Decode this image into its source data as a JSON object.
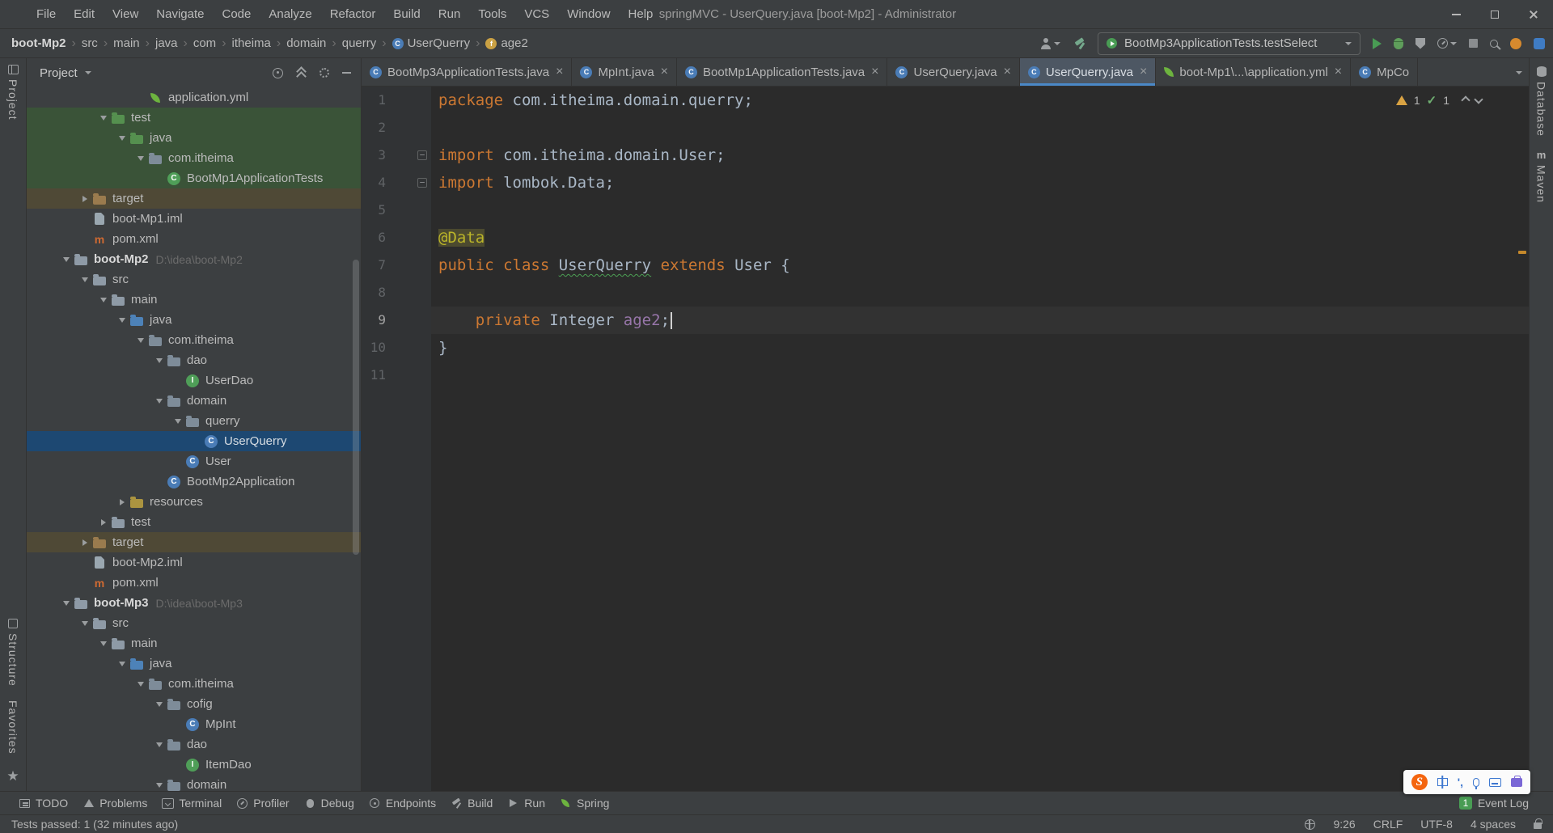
{
  "titlebar": {
    "menus": [
      "File",
      "Edit",
      "View",
      "Navigate",
      "Code",
      "Analyze",
      "Refactor",
      "Build",
      "Run",
      "Tools",
      "VCS",
      "Window",
      "Help"
    ],
    "title": "springMVC - UserQuery.java [boot-Mp2] - Administrator"
  },
  "navbar": {
    "breadcrumbs": [
      {
        "label": "boot-Mp2",
        "bold": true
      },
      {
        "label": "src"
      },
      {
        "label": "main"
      },
      {
        "label": "java"
      },
      {
        "label": "com"
      },
      {
        "label": "itheima"
      },
      {
        "label": "domain"
      },
      {
        "label": "querry"
      },
      {
        "label": "UserQuerry",
        "icon": "class"
      },
      {
        "label": "age2",
        "icon": "field"
      }
    ],
    "run_config": "BootMp3ApplicationTests.testSelect",
    "actions": [
      "vcs-users",
      "build-hammer",
      "run",
      "debug",
      "coverage",
      "profiler",
      "stop",
      "search-everywhere",
      "updates",
      "plugin"
    ]
  },
  "left_stripe": {
    "project": "Project",
    "structure": "Structure",
    "favorites": "Favorites"
  },
  "right_stripe": {
    "database": "Database",
    "maven": "Maven"
  },
  "project_panel": {
    "title": "Project",
    "tree": [
      {
        "label": "application.yml",
        "level": 5,
        "icon": "spring"
      },
      {
        "label": "test",
        "level": 3,
        "icon": "folder-test",
        "chevron": "open",
        "row": "green"
      },
      {
        "label": "java",
        "level": 4,
        "icon": "folder-test",
        "chevron": "open",
        "row": "green"
      },
      {
        "label": "com.itheima",
        "level": 5,
        "icon": "package",
        "chevron": "open",
        "row": "green"
      },
      {
        "label": "BootMp1ApplicationTests",
        "level": 6,
        "icon": "class-test",
        "row": "green"
      },
      {
        "label": "target",
        "level": 2,
        "icon": "folder-excluded",
        "chevron": "closed",
        "row": "orange"
      },
      {
        "label": "boot-Mp1.iml",
        "level": 2,
        "icon": "file"
      },
      {
        "label": "pom.xml",
        "level": 2,
        "icon": "maven-file"
      },
      {
        "label": "boot-Mp2",
        "level": 1,
        "icon": "module",
        "chevron": "open",
        "bold": true,
        "extra": "D:\\idea\\boot-Mp2"
      },
      {
        "label": "src",
        "level": 2,
        "icon": "folder",
        "chevron": "open"
      },
      {
        "label": "main",
        "level": 3,
        "icon": "folder",
        "chevron": "open"
      },
      {
        "label": "java",
        "level": 4,
        "icon": "folder-source",
        "chevron": "open"
      },
      {
        "label": "com.itheima",
        "level": 5,
        "icon": "package",
        "chevron": "open"
      },
      {
        "label": "dao",
        "level": 6,
        "icon": "package",
        "chevron": "open"
      },
      {
        "label": "UserDao",
        "level": 7,
        "icon": "interface"
      },
      {
        "label": "domain",
        "level": 6,
        "icon": "package",
        "chevron": "open"
      },
      {
        "label": "querry",
        "level": 7,
        "icon": "package",
        "chevron": "open"
      },
      {
        "label": "UserQuerry",
        "level": 8,
        "icon": "class",
        "row": "selected"
      },
      {
        "label": "User",
        "level": 7,
        "icon": "class"
      },
      {
        "label": "BootMp2Application",
        "level": 6,
        "icon": "class"
      },
      {
        "label": "resources",
        "level": 4,
        "icon": "folder-resources",
        "chevron": "closed"
      },
      {
        "label": "test",
        "level": 3,
        "icon": "folder",
        "chevron": "closed"
      },
      {
        "label": "target",
        "level": 2,
        "icon": "folder-excluded",
        "chevron": "closed",
        "row": "orange"
      },
      {
        "label": "boot-Mp2.iml",
        "level": 2,
        "icon": "file"
      },
      {
        "label": "pom.xml",
        "level": 2,
        "icon": "maven-file"
      },
      {
        "label": "boot-Mp3",
        "level": 1,
        "icon": "module",
        "chevron": "open",
        "bold": true,
        "extra": "D:\\idea\\boot-Mp3"
      },
      {
        "label": "src",
        "level": 2,
        "icon": "folder",
        "chevron": "open"
      },
      {
        "label": "main",
        "level": 3,
        "icon": "folder",
        "chevron": "open"
      },
      {
        "label": "java",
        "level": 4,
        "icon": "folder-source",
        "chevron": "open"
      },
      {
        "label": "com.itheima",
        "level": 5,
        "icon": "package",
        "chevron": "open"
      },
      {
        "label": "cofig",
        "level": 6,
        "icon": "package",
        "chevron": "open"
      },
      {
        "label": "MpInt",
        "level": 7,
        "icon": "class"
      },
      {
        "label": "dao",
        "level": 6,
        "icon": "package",
        "chevron": "open"
      },
      {
        "label": "ItemDao",
        "level": 7,
        "icon": "interface"
      },
      {
        "label": "domain",
        "level": 6,
        "icon": "package",
        "chevron": "open"
      }
    ]
  },
  "editor": {
    "tabs": [
      {
        "label": "BootMp3ApplicationTests.java",
        "icon": "class"
      },
      {
        "label": "MpInt.java",
        "icon": "class"
      },
      {
        "label": "BootMp1ApplicationTests.java",
        "icon": "class"
      },
      {
        "label": "UserQuery.java",
        "icon": "class"
      },
      {
        "label": "UserQuerry.java",
        "icon": "class",
        "active": true
      },
      {
        "label": "boot-Mp1\\...\\application.yml",
        "icon": "spring"
      },
      {
        "label": "MpCo",
        "icon": "class",
        "truncated": true
      }
    ],
    "inspections": {
      "warnings": "1",
      "passed": "1"
    },
    "code_lines": [
      {
        "num": "1",
        "segs": [
          {
            "t": "package ",
            "s": "kw"
          },
          {
            "t": "com.itheima.domain.querry;",
            "s": "pl"
          }
        ]
      },
      {
        "num": "2",
        "segs": []
      },
      {
        "num": "3",
        "fold": true,
        "segs": [
          {
            "t": "import ",
            "s": "kw"
          },
          {
            "t": "com.itheima.domain.User;",
            "s": "pl"
          }
        ]
      },
      {
        "num": "4",
        "fold": true,
        "segs": [
          {
            "t": "import ",
            "s": "kw"
          },
          {
            "t": "lombok.Data;",
            "s": "pl"
          }
        ]
      },
      {
        "num": "5",
        "segs": []
      },
      {
        "num": "6",
        "segs": [
          {
            "t": "@Data",
            "s": "ann hl"
          }
        ]
      },
      {
        "num": "7",
        "segs": [
          {
            "t": "public class ",
            "s": "kw"
          },
          {
            "t": "UserQuerry",
            "s": "pl typo"
          },
          {
            "t": " ",
            "s": "pl"
          },
          {
            "t": "extends",
            "s": "kw"
          },
          {
            "t": " User {",
            "s": "pl"
          }
        ]
      },
      {
        "num": "8",
        "segs": []
      },
      {
        "num": "9",
        "caret": true,
        "segs": [
          {
            "t": "    ",
            "s": "pl"
          },
          {
            "t": "private ",
            "s": "kw"
          },
          {
            "t": "Integer ",
            "s": "pl"
          },
          {
            "t": "age2",
            "s": "fld"
          },
          {
            "t": ";",
            "s": "pl"
          }
        ]
      },
      {
        "num": "10",
        "segs": [
          {
            "t": "}",
            "s": "pl"
          }
        ]
      },
      {
        "num": "11",
        "segs": []
      }
    ]
  },
  "bottom_bar": {
    "items": [
      {
        "label": "TODO",
        "icon": "todo"
      },
      {
        "label": "Problems",
        "icon": "problems"
      },
      {
        "label": "Terminal",
        "icon": "terminal"
      },
      {
        "label": "Profiler",
        "icon": "profiler"
      },
      {
        "label": "Debug",
        "icon": "debug"
      },
      {
        "label": "Endpoints",
        "icon": "endpoints"
      },
      {
        "label": "Build",
        "icon": "build"
      },
      {
        "label": "Run",
        "icon": "run"
      },
      {
        "label": "Spring",
        "icon": "spring"
      }
    ],
    "event_log": {
      "badge": "1",
      "label": "Event Log"
    }
  },
  "status_bar": {
    "message": "Tests passed: 1 (32 minutes ago)",
    "caret_position": "9:26",
    "line_ending": "CRLF",
    "encoding": "UTF-8",
    "indent": "4 spaces"
  },
  "ime_bar": {
    "logo": "S",
    "chinese": "中",
    "punct": "',"
  },
  "colors": {
    "panel_bg": "#3c3f41",
    "editor_bg": "#2b2b2b",
    "accent_blue": "#4a88c7",
    "selection_blue": "#1d4872",
    "test_scope_green": "#3a5338",
    "excluded_orange": "#4f4936",
    "keyword_orange": "#cc7832",
    "annotation_yellow": "#bbb529",
    "field_purple": "#9876aa",
    "spring_green": "#6db33f",
    "run_green": "#499c54",
    "warning_yellow": "#d9a343",
    "sogou_orange": "#f4650f"
  }
}
